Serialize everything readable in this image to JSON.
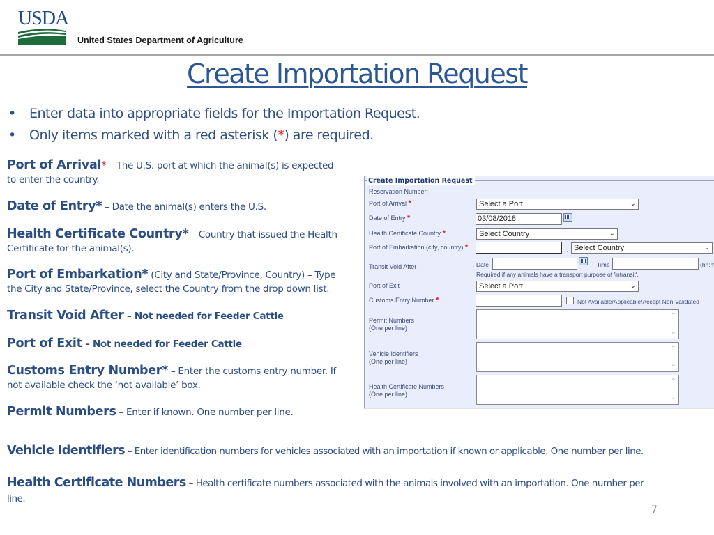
{
  "header": {
    "logo_text": "USDA",
    "department": "United States Department of Agriculture",
    "colors": {
      "logo_blue": "#1c4c8c",
      "logo_green": "#1e6b3b",
      "rule": "#a6a6a6"
    }
  },
  "title": "Create Importation Request",
  "bullets": [
    {
      "text": "Enter data into appropriate fields for the Importation Request."
    },
    {
      "prefix": "Only items marked with a red asterisk (",
      "asterisk": "*",
      "suffix": ") are required."
    }
  ],
  "fields": [
    {
      "term": "Port of Arrival",
      "required": "*",
      "dash": " – ",
      "desc": "The U.S. port at which the animal(s) is expected",
      "desc2": "to enter the country."
    },
    {
      "term": "Date of Entry",
      "required": "*",
      "dash": " – ",
      "desc": "Date the animal(s) enters the U.S."
    },
    {
      "term": "Health Certificate Country",
      "required": "*",
      "dash": " – ",
      "desc": "Country that issued the Health",
      "desc2": "Certificate for the animal(s)."
    },
    {
      "term": "Port of Embarkation",
      "required": "*",
      "paren": " (City and State/Province, Country)",
      "dash": " – ",
      "desc": "Type",
      "desc2": "the City and State/Province, select the Country from the drop down list."
    },
    {
      "term": "Transit Void After",
      "dash": " – ",
      "desc": "Not needed for Feeder Cattle"
    },
    {
      "term": "Port of Exit",
      "dash": " – ",
      "desc": "Not needed for Feeder Cattle"
    },
    {
      "term": "Customs Entry Number",
      "required": "*",
      "dash": " – ",
      "desc": "Enter the customs entry number.  If",
      "desc2": "not available check the ‘not available’ box."
    },
    {
      "term": "Permit Numbers",
      "dash": " – ",
      "desc": "Enter if known.  One number per line."
    },
    {
      "term": "Vehicle Identifiers",
      "dash": " – ",
      "desc": "Enter identification numbers for vehicles associated with an importation if known or applicable.  One number per line."
    },
    {
      "term": "Health Certificate Numbers",
      "dash": " – ",
      "desc": "Health certificate numbers associated with the animals involved with an importation.   One number per",
      "desc2": "line."
    }
  ],
  "form": {
    "legend": "Create Importation Request",
    "reservation_label": "Reservation Number:",
    "port_of_arrival": {
      "label": "Port of Arrival",
      "required": "*",
      "value": "Select a Port"
    },
    "date_of_entry": {
      "label": "Date of Entry",
      "required": "*",
      "value": "03/08/2018"
    },
    "health_cert_country": {
      "label": "Health Certificate Country",
      "required": "*",
      "value": "Select Country"
    },
    "port_of_embarkation": {
      "label": "Port of Embarkation (city, country)",
      "required": "*",
      "city_value": "",
      "separator": ",",
      "country_value": "Select Country"
    },
    "transit_void_after": {
      "label": "Transit Void After",
      "date_label": "Date",
      "date_value": "",
      "time_label": "Time",
      "time_value": "",
      "time_format": "(hh:m",
      "note": "Required if any animals have a transport purpose of 'intransit'."
    },
    "port_of_exit": {
      "label": "Port of Exit",
      "value": "Select a Port"
    },
    "customs_entry": {
      "label": "Customs Entry Number",
      "required": "*",
      "value": "",
      "checkbox_label": "Not Available/Applicable/Accept Non-Validated",
      "checked": false
    },
    "permit_numbers": {
      "label": "Permit Numbers",
      "sub": "(One per line)",
      "value": ""
    },
    "vehicle_identifiers": {
      "label": "Vehicle Identifiers",
      "sub": "(One per line)",
      "value": ""
    },
    "health_cert_numbers": {
      "label": "Health Certificate Numbers",
      "sub": "(One per line)",
      "value": ""
    },
    "colors": {
      "panel_bg": "#eaeefc",
      "label": "#3a4d7a",
      "required": "#e11b1b",
      "legend": "#1c3a73"
    }
  },
  "page_number": "7",
  "colors": {
    "title": "#2b5797",
    "body_text": "#2b4d86",
    "asterisk": "#e11b1b"
  }
}
